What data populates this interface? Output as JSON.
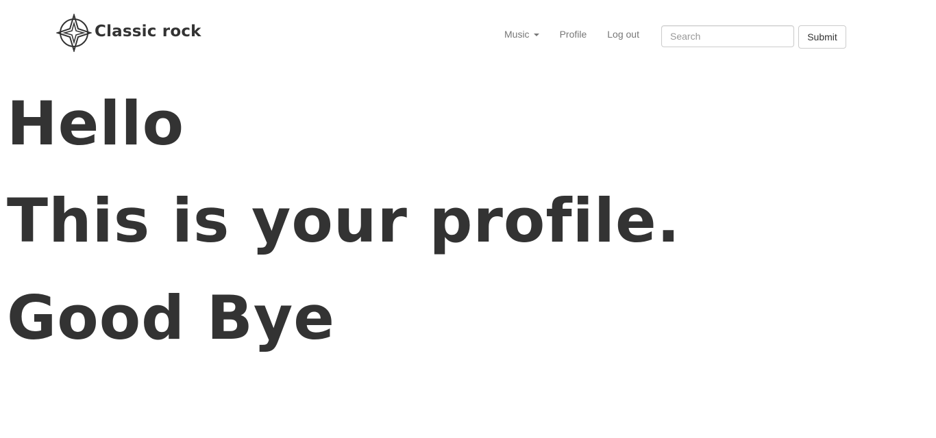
{
  "navbar": {
    "brand": {
      "logo_icon": "compass-star-icon",
      "name": "Classic rock"
    },
    "menu": {
      "music_label": "Music",
      "music_icon": "caret-down-icon",
      "profile_label": "Profile",
      "logout_label": "Log out"
    },
    "search": {
      "placeholder": "Search",
      "value": ""
    },
    "submit_label": "Submit"
  },
  "main": {
    "greeting": "Hello",
    "message": "This is your profile.",
    "farewell": "Good Bye"
  },
  "colors": {
    "text": "#333333",
    "nav_link": "#777777",
    "border": "#cccccc",
    "background": "#ffffff"
  }
}
